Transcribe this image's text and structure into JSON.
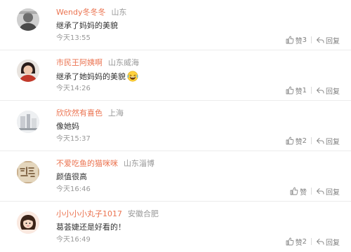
{
  "comments": [
    {
      "name": "Wendy冬冬冬",
      "location": "山东",
      "text": "继承了妈妈的美貌",
      "time": "今天13:55",
      "like_label": "赞",
      "like_count": "3",
      "reply_label": "回复",
      "has_emoji": false,
      "avatar_color": "#6d6d6d"
    },
    {
      "name": "市民王阿姨啊",
      "location": "山东威海",
      "text": "继承了她妈妈的美貌",
      "time": "今天14:26",
      "like_label": "赞",
      "like_count": "1",
      "reply_label": "回复",
      "has_emoji": true,
      "emoji_icon": "laughing-emoji-icon",
      "avatar_color": "#c23a2b"
    },
    {
      "name": "欣欣然有喜色",
      "location": "上海",
      "text": "像她妈",
      "time": "今天15:37",
      "like_label": "赞",
      "like_count": "2",
      "reply_label": "回复",
      "has_emoji": false,
      "avatar_color": "#c9ccd1"
    },
    {
      "name": "不爱吃鱼的猫咪咪",
      "location": "山东淄博",
      "text": "颜值很高",
      "time": "今天16:46",
      "like_label": "赞",
      "like_count": "",
      "reply_label": "回复",
      "has_emoji": false,
      "avatar_color": "#b08a5a"
    },
    {
      "name": "小小小小丸子1017",
      "location": "安徽合肥",
      "text": "葛荟婕还是好看的！",
      "time": "今天16:49",
      "like_label": "赞",
      "like_count": "2",
      "reply_label": "回复",
      "has_emoji": false,
      "avatar_color": "#f2d5c4"
    }
  ],
  "colors": {
    "name": "#eb7350",
    "meta": "#999999",
    "text": "#333333",
    "divider": "#ececec"
  },
  "icons": {
    "like": "thumbs-up-icon",
    "reply": "reply-arrow-icon"
  }
}
